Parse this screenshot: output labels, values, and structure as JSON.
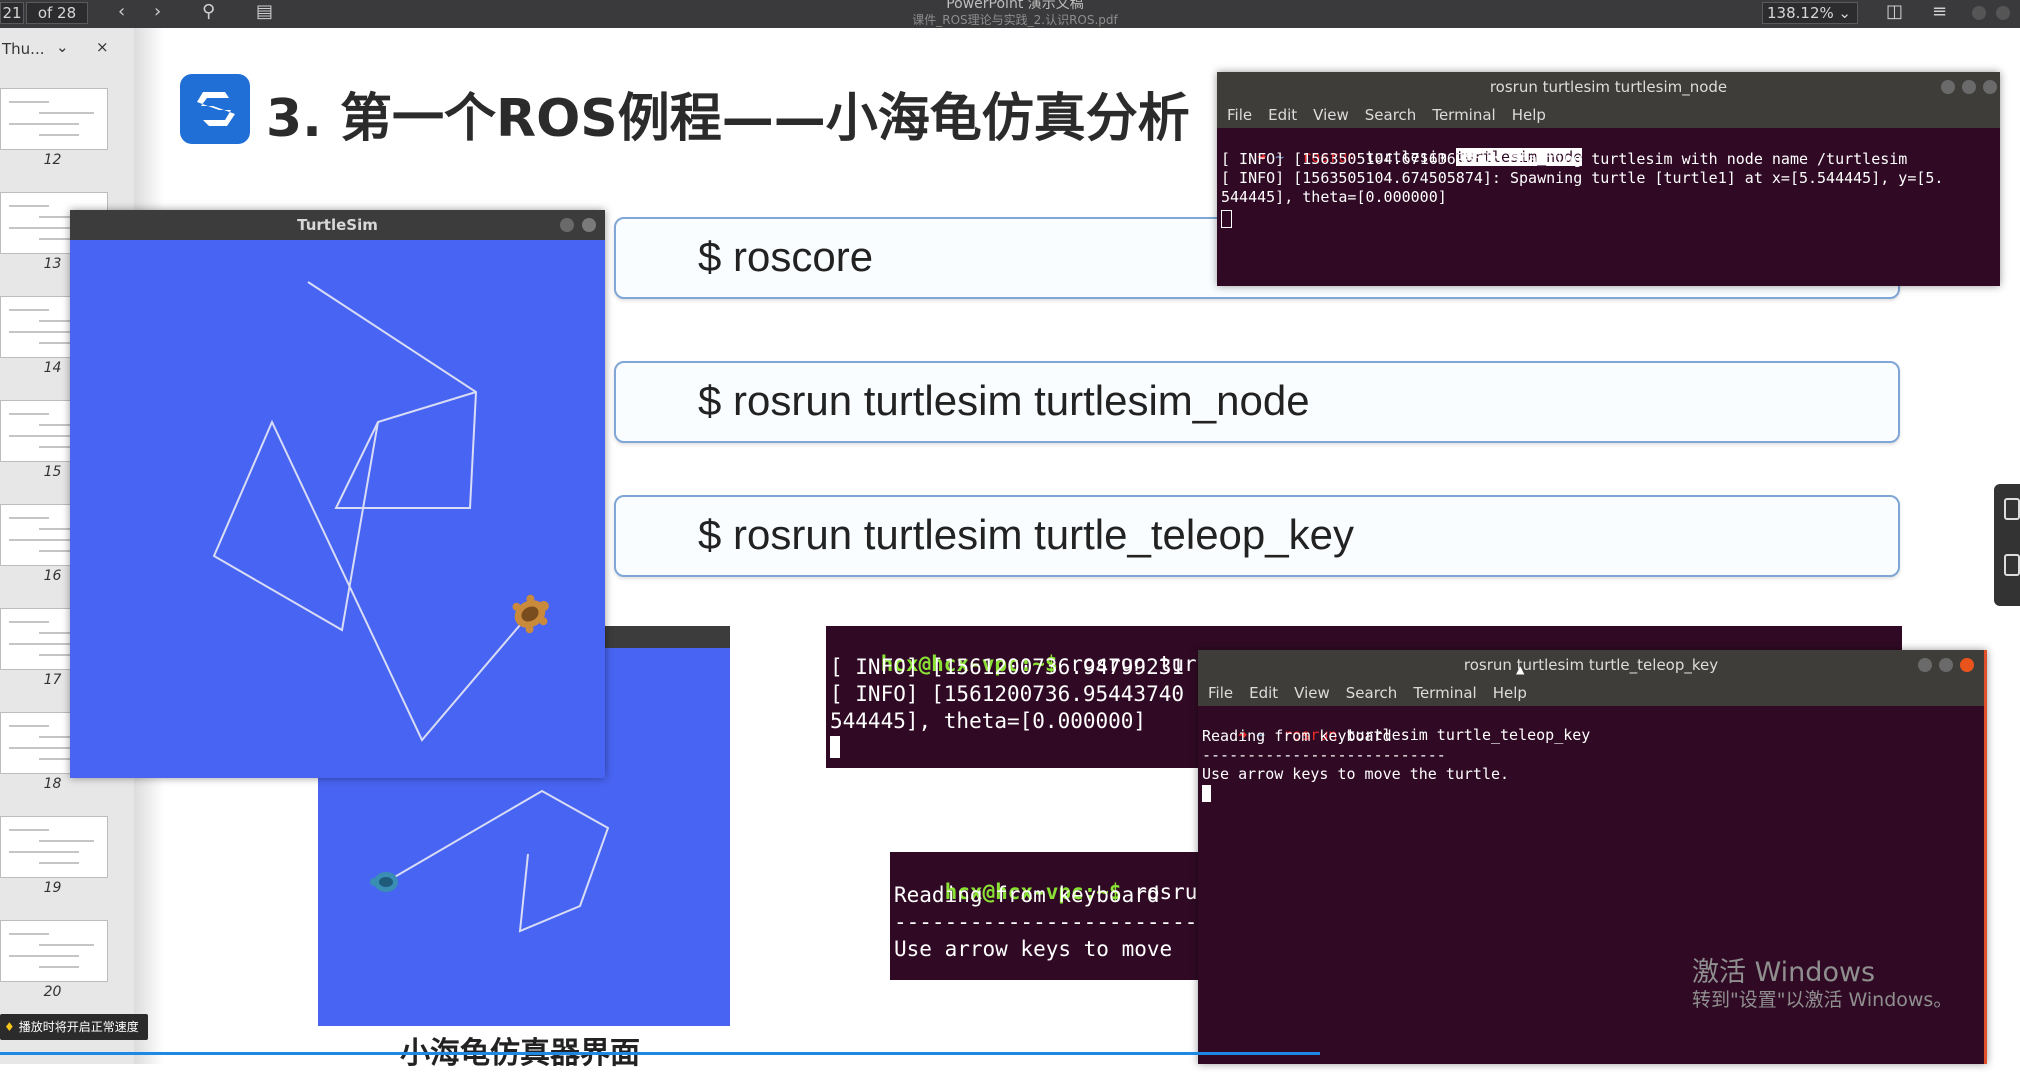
{
  "toolbar": {
    "page_current": "21",
    "page_total": "of 28",
    "app_title": "PowerPoint 演示文稿",
    "doc_name": "课件_ROS理论与实践_2.认识ROS.pdf",
    "zoom": "138.12%",
    "icons": [
      "chevron-left-icon",
      "chevron-right-icon",
      "search-icon",
      "document-icon",
      "page-icon",
      "menu-icon"
    ]
  },
  "thumbnails": {
    "panel_label": "Thu...",
    "close": "×",
    "pages": [
      "12",
      "13",
      "14",
      "15",
      "16",
      "17",
      "18",
      "19",
      "20"
    ]
  },
  "slide": {
    "title": "3. 第一个ROS例程——小海龟仿真分析",
    "commands": [
      "$ roscore",
      "$ rosrun turtlesim turtlesim_node",
      "$ rosrun turtlesim turtle_teleop_key"
    ],
    "caption": "小海龟仿真器界面",
    "embedded_terminal_1": {
      "prompt": "hcx@hcx-vpc:~$",
      "command": " rosrun turtlesim turtlesim_node",
      "lines": [
        "[ INFO] [1561200736.94799231",
        "[ INFO] [1561200736.95443740",
        "544445], theta=[0.000000]"
      ]
    },
    "embedded_terminal_2": {
      "prompt": "hcx@hcx-vpc:~$",
      "command": " rosrun t",
      "lines": [
        "Reading from keyboard",
        "---------------------------",
        "Use arrow keys to move"
      ]
    }
  },
  "turtlesim_window": {
    "title": "TurtleSim",
    "background_color": "#4864f2",
    "trail_color": "#d8dcf5"
  },
  "terminal_node": {
    "title": "rosrun turtlesim turtlesim_node",
    "menu": [
      "File",
      "Edit",
      "View",
      "Search",
      "Terminal",
      "Help"
    ],
    "prompt_arrow": "➜",
    "prompt_dir": " ~ ",
    "cmd_part": " rosrun",
    "cmd_arg": " turtlesim ",
    "cmd_hl": "turtlesim_node",
    "lines": [
      "[ INFO] [1563505104.671636985]: Starting turtlesim with node name /turtlesim",
      "[ INFO] [1563505104.674505874]: Spawning turtle [turtle1] at x=[5.544445], y=[5.",
      "544445], theta=[0.000000]"
    ]
  },
  "terminal_teleop": {
    "title": "rosrun turtlesim turtle_teleop_key",
    "menu": [
      "File",
      "Edit",
      "View",
      "Search",
      "Terminal",
      "Help"
    ],
    "prompt_arrow": "➜",
    "prompt_dir": " ~ ",
    "cmd_part": " rosrun",
    "cmd_rest": " turtlesim turtle_teleop_key",
    "lines": [
      "Reading from keyboard",
      "---------------------------",
      "Use arrow keys to move the turtle."
    ]
  },
  "watermark": {
    "line1": "激活 Windows",
    "line2": "转到\"设置\"以激活 Windows。"
  },
  "tooltip": "播放时将开启正常速度"
}
